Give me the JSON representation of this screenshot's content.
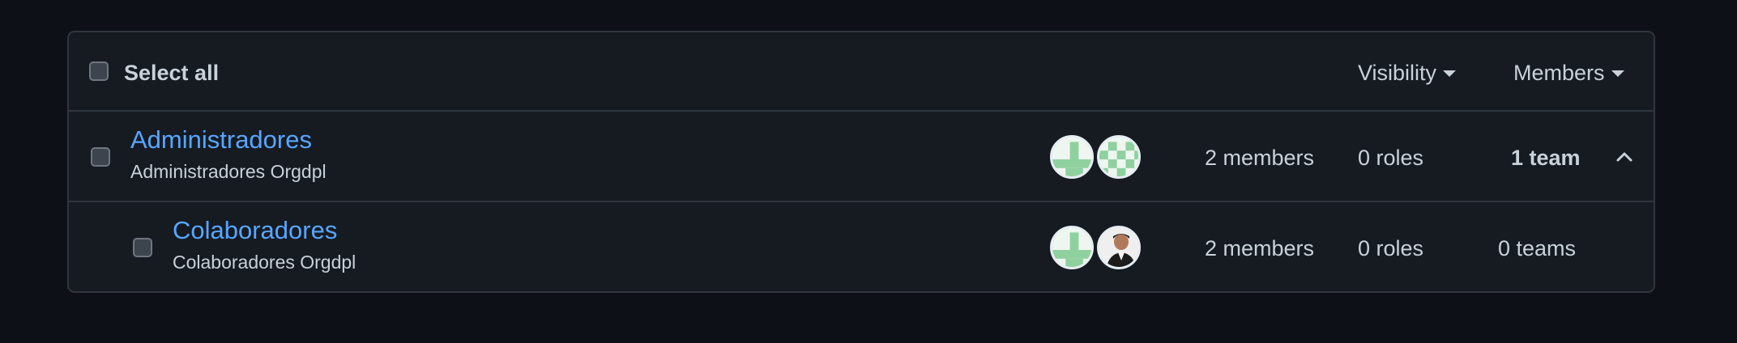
{
  "header": {
    "select_all_label": "Select all",
    "visibility_label": "Visibility",
    "members_label": "Members"
  },
  "teams": [
    {
      "name": "Administradores",
      "description": "Administradores Orgdpl",
      "members": "2 members",
      "roles": "0 roles",
      "teams": "1 team",
      "expanded": true
    },
    {
      "name": "Colaboradores",
      "description": "Colaboradores Orgdpl",
      "members": "2 members",
      "roles": "0 roles",
      "teams": "0 teams"
    }
  ],
  "colors": {
    "background": "#0d1117",
    "panel": "#161b22",
    "border": "#30363d",
    "link": "#58a6ff",
    "text": "#c9d1d9",
    "identicon_green": "#8fd19e"
  },
  "icons": {
    "dropdown": "triangle-down-icon",
    "collapse": "chevron-up-icon"
  }
}
